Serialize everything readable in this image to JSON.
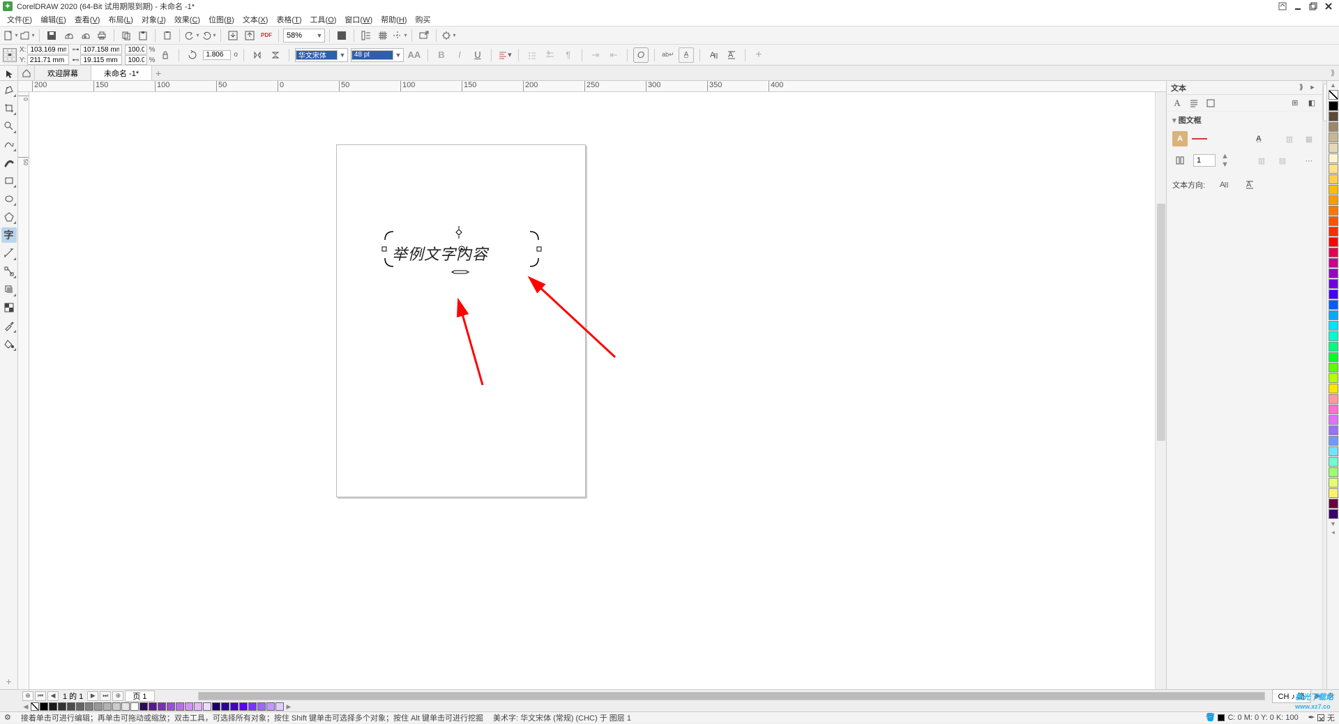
{
  "app": {
    "title": "CorelDRAW 2020 (64-Bit 试用期限到期) - 未命名 -1*"
  },
  "menu": {
    "items": [
      {
        "label": "文件",
        "accel": "F"
      },
      {
        "label": "编辑",
        "accel": "E"
      },
      {
        "label": "查看",
        "accel": "V"
      },
      {
        "label": "布局",
        "accel": "L"
      },
      {
        "label": "对象",
        "accel": "J"
      },
      {
        "label": "效果",
        "accel": "C"
      },
      {
        "label": "位图",
        "accel": "B"
      },
      {
        "label": "文本",
        "accel": "X"
      },
      {
        "label": "表格",
        "accel": "T"
      },
      {
        "label": "工具",
        "accel": "O"
      },
      {
        "label": "窗口",
        "accel": "W"
      },
      {
        "label": "帮助",
        "accel": "H"
      },
      {
        "label": "购买",
        "accel": ""
      }
    ]
  },
  "standard_toolbar": {
    "zoom": "58%"
  },
  "property_bar": {
    "x": "103.169 mm",
    "y": "211.71 mm",
    "w": "107.158 mm",
    "h": "19.115 mm",
    "sx": "100.0",
    "sy": "100.0",
    "pct": "%",
    "rotation": "1.806",
    "deg": "o",
    "font_name": "华文宋体",
    "font_size": "48 pt"
  },
  "doc_tabs": {
    "welcome": "欢迎屏幕",
    "doc1": "未命名 -1*"
  },
  "ruler": {
    "hticks": [
      "200",
      "150",
      "100",
      "50",
      "0",
      "50",
      "100",
      "150",
      "200",
      "250",
      "300",
      "350",
      "400"
    ],
    "vticks": [
      "0",
      "50"
    ]
  },
  "canvas": {
    "text_content": "举例文字内容"
  },
  "pagenav": {
    "range": "1 的 1",
    "page_label": "页 1",
    "lang": "CH ♪ 简"
  },
  "docker": {
    "title": "文本",
    "section1": "图文框",
    "columns_value": "1",
    "direction_label": "文本方向:"
  },
  "palette": {
    "colors": [
      "#000000",
      "#ffffff",
      "#f2efe6",
      "#fff6cc",
      "#f4f0a4",
      "#fff100",
      "#ffc20e",
      "#f58220",
      "#ed1c24",
      "#da1c5c",
      "#ec008c",
      "#92278f",
      "#662d91",
      "#2e3192",
      "#1b75bc",
      "#00aeef",
      "#00a79d",
      "#00a651",
      "#8dc63f",
      "#fff200"
    ],
    "vcolors": [
      "#000000",
      "#5b4a3a",
      "#9b8868",
      "#c8b892",
      "#e4d9b6",
      "#fff4cc",
      "#ffe28a",
      "#ffcf4a",
      "#ffbd00",
      "#ff9b00",
      "#ff7800",
      "#ff5400",
      "#ff2a00",
      "#ff0000",
      "#e30052",
      "#c60094",
      "#9b00c6",
      "#6f00e3",
      "#4200ff",
      "#005eff",
      "#00aaff",
      "#00e4ff",
      "#00ffd0",
      "#00ff80",
      "#00ff2a",
      "#5eff00",
      "#b4ff00",
      "#ffe600",
      "#ff9b9b",
      "#ff6fd0",
      "#e36fff",
      "#9b6fff",
      "#6f9bff",
      "#6fe3ff",
      "#6fffd0",
      "#9bff6f",
      "#e3ff6f",
      "#fff06f",
      "#6b003a",
      "#3a006b"
    ]
  },
  "hpalette": {
    "colors": [
      "#000000",
      "#1a1a1a",
      "#333333",
      "#4d4d4d",
      "#666666",
      "#808080",
      "#999999",
      "#b3b3b3",
      "#cccccc",
      "#e6e6e6",
      "#ffffff",
      "#2e0854",
      "#551a8b",
      "#7a2fb5",
      "#9b4ed9",
      "#b86ef0",
      "#cf93f7",
      "#e3b8fb",
      "#f0dafe",
      "#1a0066",
      "#2e0099",
      "#4300cc",
      "#5700ff",
      "#7a33ff",
      "#9d66ff",
      "#c099ff",
      "#e3ccff"
    ]
  },
  "status": {
    "gear_hint": "接着单击可进行编辑；再单击可拖动或缩放；双击工具，可选择所有对象；按住 Shift 键单击可选择多个对象；按住 Alt 键单击可进行挖掘",
    "object_info": "美术字:   华文宋体 (常规) (CHC) 于 图层 1",
    "cmyk": "C:   0 M:   0 Y:   0 K: 100",
    "outline": "无"
  },
  "watermark": {
    "brand": "极光下载站",
    "url": "www.xz7.co"
  }
}
